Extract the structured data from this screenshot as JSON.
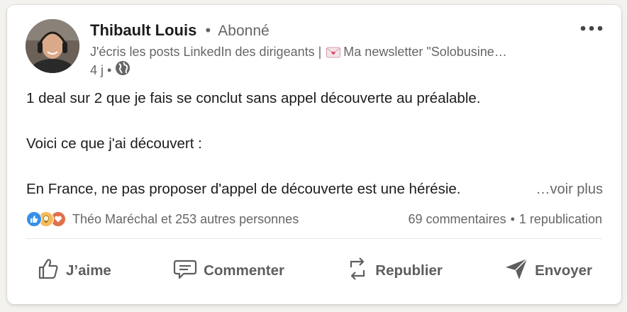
{
  "post": {
    "author_name": "Thibault Louis",
    "separator": "•",
    "follow_status": "Abonné",
    "headline_part1": "J'écris les posts LinkedIn des dirigeants |",
    "headline_part2": "Ma newsletter \"Solobusine…",
    "time_ago": "4 j",
    "meta_separator": "•",
    "body_line1": "1 deal sur 2 que je fais se conclut sans appel découverte au préalable.",
    "body_line2": "Voici ce que j'ai découvert :",
    "body_line3": "En France, ne pas proposer d'appel de découverte est une hérésie.",
    "see_more": "…voir plus"
  },
  "social": {
    "reactors": "Théo Maréchal et 253 autres personnes",
    "comments": "69 commentaires",
    "separator": "•",
    "reposts": "1 republication"
  },
  "actions": {
    "like": "J’aime",
    "comment": "Commenter",
    "repost": "Republier",
    "send": "Envoyer"
  },
  "icons": {
    "like": "thumbs-up-icon",
    "comment": "comment-icon",
    "repost": "repost-icon",
    "send": "send-icon",
    "visibility": "globe-icon",
    "more": "more-icon"
  },
  "colors": {
    "text": "#1c1c1c",
    "muted": "#666666",
    "like_blue": "#378fe9",
    "celebrate_yellow": "#f5bb5c",
    "love_red": "#df704d"
  }
}
